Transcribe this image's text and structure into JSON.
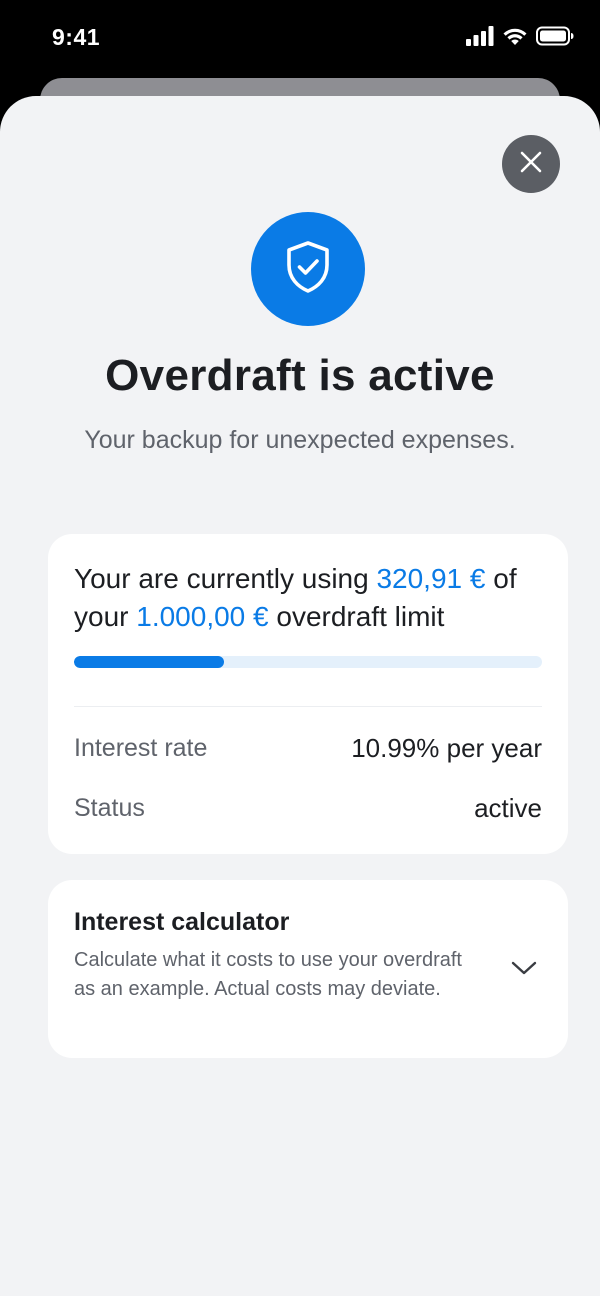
{
  "status_bar": {
    "time": "9:41",
    "icons": [
      "signal-icon",
      "wifi-icon",
      "battery-icon"
    ]
  },
  "close_button": {
    "icon": "close-icon"
  },
  "hero": {
    "icon": "shield-check-icon",
    "title": "Overdraft is active",
    "subtitle": "Your backup for unexpected expenses."
  },
  "usage": {
    "text_before": "Your are currently using ",
    "used_amount": "320,91 €",
    "text_middle": " of your ",
    "limit_amount": "1.000,00 €",
    "text_after": " overdraft limit",
    "progress_fraction": 0.3209
  },
  "details": [
    {
      "label": "Interest rate",
      "value": "10.99% per year"
    },
    {
      "label": "Status",
      "value": "active"
    }
  ],
  "calculator": {
    "title": "Interest calculator",
    "description": "Calculate what it costs to use your overdraft as an example. Actual costs may deviate.",
    "icon": "chevron-down-icon"
  },
  "colors": {
    "accent": "#0a7be6",
    "progress_track": "#e4f0fb",
    "background": "#f2f3f5",
    "close_button": "#5b5e64"
  }
}
